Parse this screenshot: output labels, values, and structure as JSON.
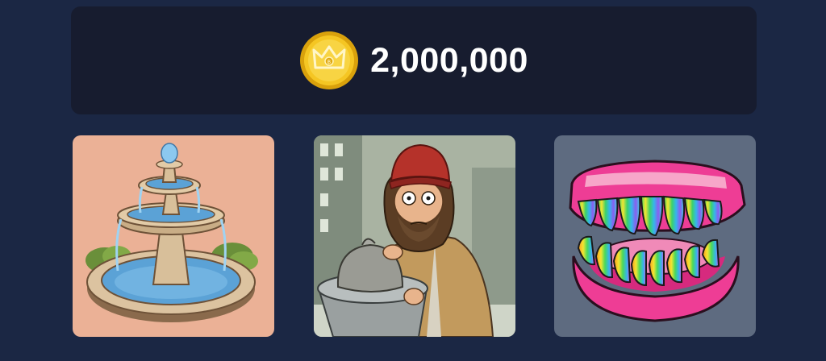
{
  "balance": {
    "icon": "crown-coin-icon",
    "amount": "2,000,000",
    "coin_color": "#f2c21b"
  },
  "cards": [
    {
      "icon": "fountain-image",
      "bg": "#ebb196"
    },
    {
      "icon": "homeless-man-trash-can-image",
      "bg": "#a9b3a2"
    },
    {
      "icon": "rainbow-teeth-dentures-image",
      "bg": "#5e6b80"
    }
  ],
  "colors": {
    "page_bg": "#1b2744",
    "panel_bg": "#171c2f",
    "text": "#ffffff"
  }
}
